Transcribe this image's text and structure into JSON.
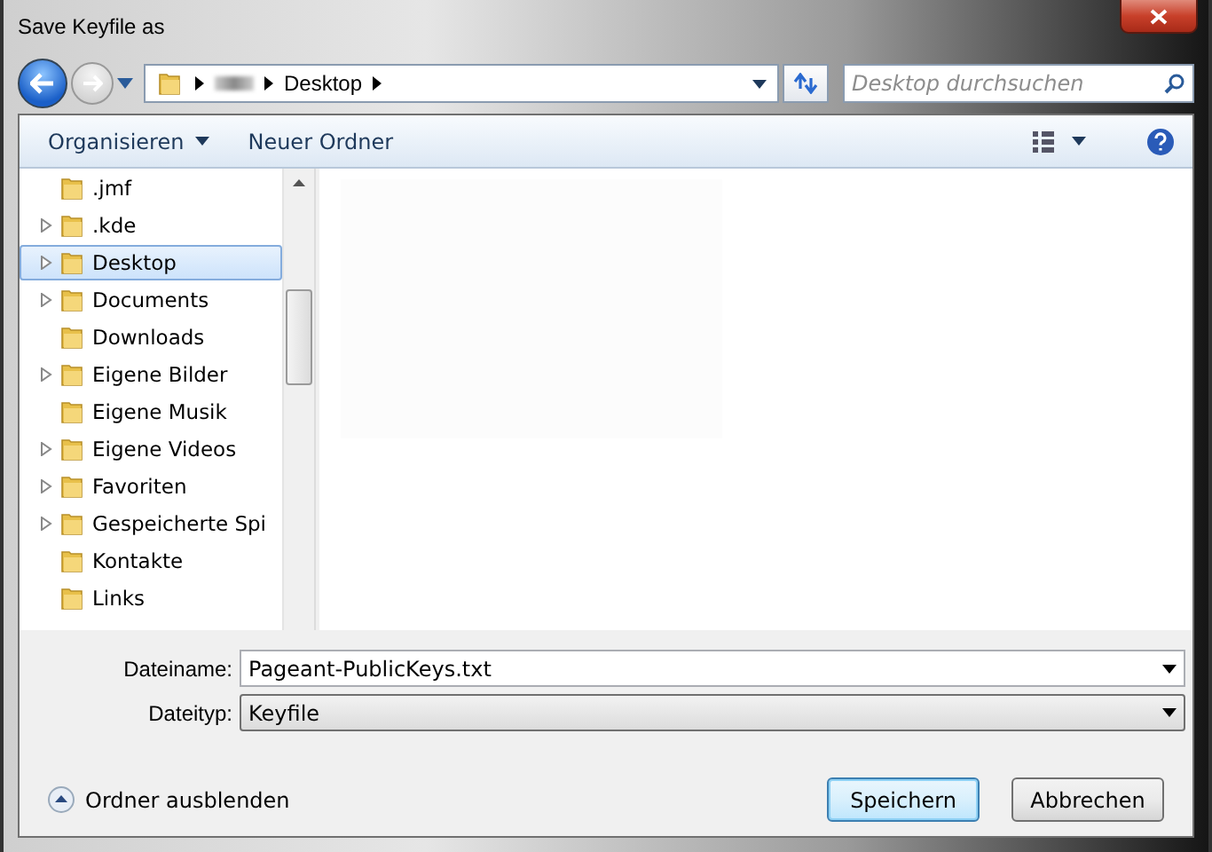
{
  "window": {
    "title": "Save Keyfile as"
  },
  "address": {
    "segments": [
      "Desktop"
    ],
    "hidden_segment": true
  },
  "search": {
    "placeholder": "Desktop durchsuchen"
  },
  "toolbar": {
    "organize": "Organisieren",
    "new_folder": "Neuer Ordner"
  },
  "tree": [
    {
      "label": ".jmf",
      "expandable": false,
      "selected": false
    },
    {
      "label": ".kde",
      "expandable": true,
      "selected": false
    },
    {
      "label": "Desktop",
      "expandable": true,
      "selected": true
    },
    {
      "label": "Documents",
      "expandable": true,
      "selected": false
    },
    {
      "label": "Downloads",
      "expandable": false,
      "selected": false
    },
    {
      "label": "Eigene Bilder",
      "expandable": true,
      "selected": false
    },
    {
      "label": "Eigene Musik",
      "expandable": false,
      "selected": false
    },
    {
      "label": "Eigene Videos",
      "expandable": true,
      "selected": false
    },
    {
      "label": "Favoriten",
      "expandable": true,
      "selected": false
    },
    {
      "label": "Gespeicherte Spi",
      "expandable": true,
      "selected": false
    },
    {
      "label": "Kontakte",
      "expandable": false,
      "selected": false
    },
    {
      "label": "Links",
      "expandable": false,
      "selected": false
    }
  ],
  "form": {
    "filename_label": "Dateiname:",
    "filename": "Pageant-PublicKeys.txt",
    "filetype_label": "Dateityp:",
    "filetype": "Keyfile"
  },
  "footer": {
    "hide_folders": "Ordner ausblenden",
    "save": "Speichern",
    "cancel": "Abbrechen"
  }
}
